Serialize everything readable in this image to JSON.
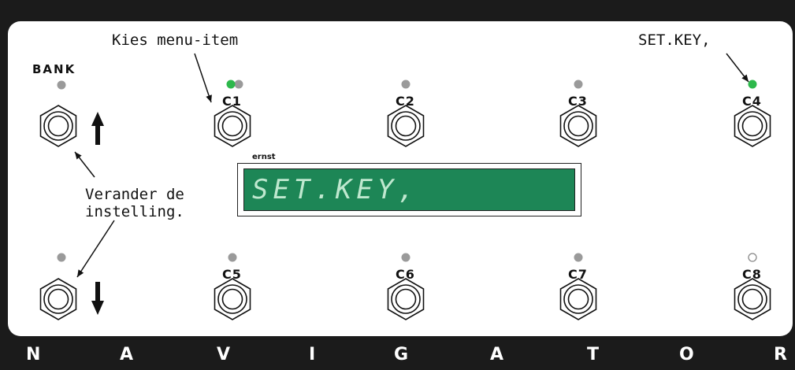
{
  "annotations": {
    "choose_item": "Kies menu-item",
    "set_key_note": "SET.KEY,",
    "change_setting": "Verander de\ninstelling."
  },
  "bank_label": "BANK",
  "display": {
    "brand": "ernst",
    "text": "SET.KEY,"
  },
  "channels": [
    {
      "label": "C1",
      "led": "green+gray"
    },
    {
      "label": "C2",
      "led": "gray"
    },
    {
      "label": "C3",
      "led": "gray"
    },
    {
      "label": "C4",
      "led": "green"
    },
    {
      "label": "C5",
      "led": "gray"
    },
    {
      "label": "C6",
      "led": "gray"
    },
    {
      "label": "C7",
      "led": "gray"
    },
    {
      "label": "C8",
      "led": "off"
    }
  ],
  "bank_buttons": [
    {
      "direction": "up",
      "icon": "arrow-up-icon",
      "led": "gray"
    },
    {
      "direction": "down",
      "icon": "arrow-down-icon",
      "led": "gray"
    }
  ],
  "footer_letters": [
    "N",
    "A",
    "V",
    "I",
    "G",
    "A",
    "T",
    "O",
    "R"
  ],
  "colors": {
    "frame": "#1b1b1b",
    "display_green": "#1d8656",
    "display_text": "#bfe8cf",
    "led_green": "#2db84b",
    "led_gray": "#9a9a9a"
  }
}
